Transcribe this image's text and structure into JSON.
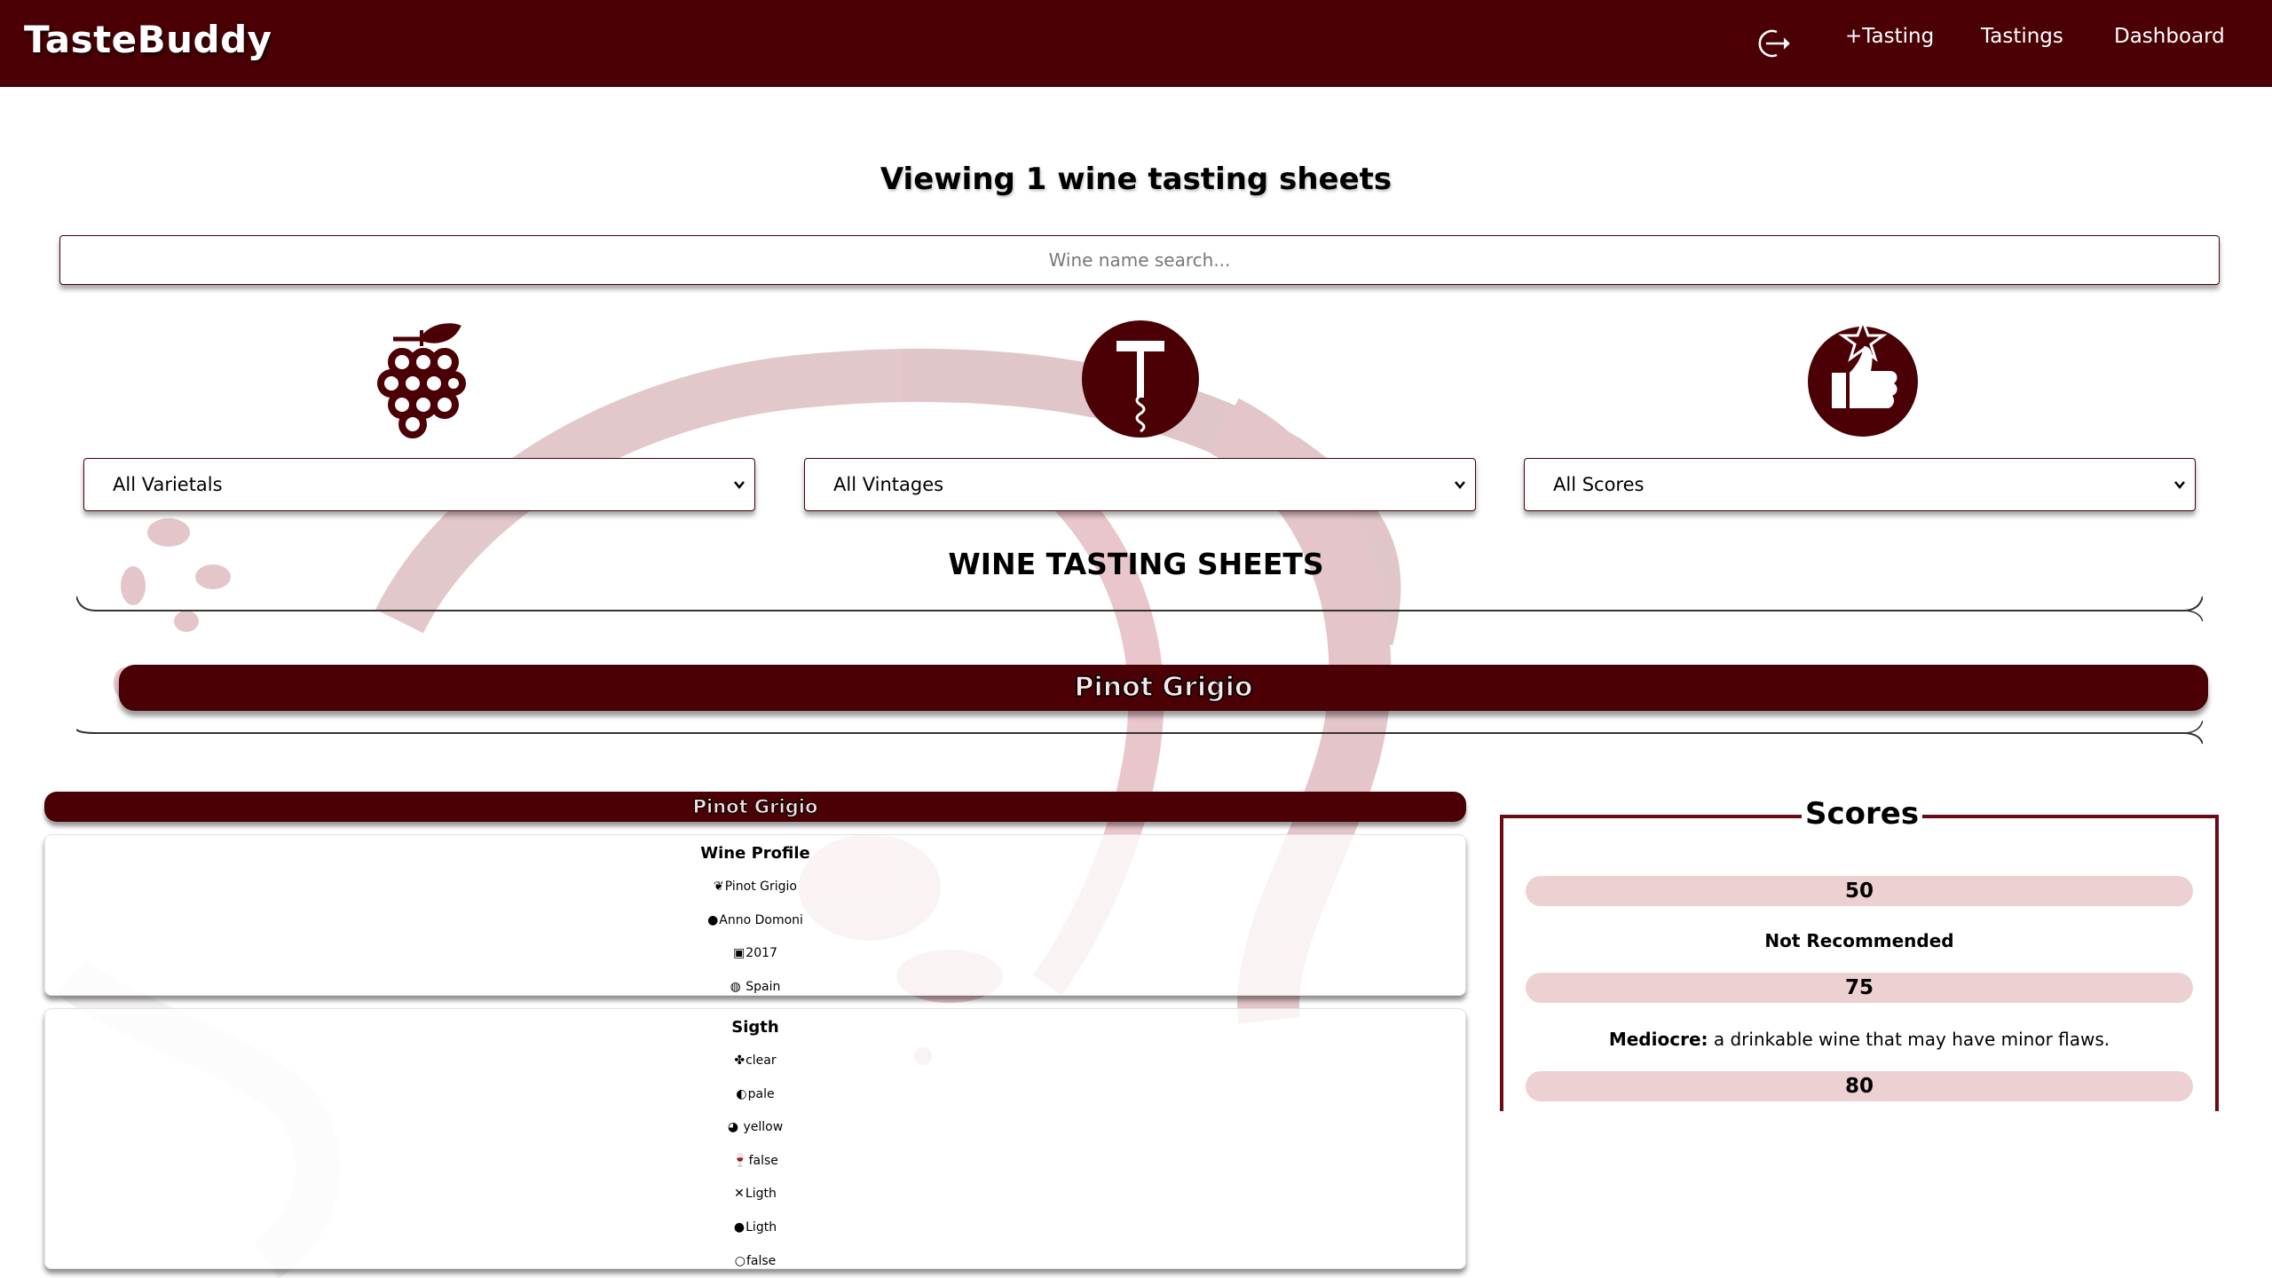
{
  "navbar": {
    "brand": "TasteBuddy",
    "links": [
      "+Tasting",
      "Tastings",
      "Dashboard"
    ],
    "logout_icon": "logout-icon",
    "background": "#4a0005"
  },
  "page_title": "Viewing 1 wine tasting sheets",
  "search": {
    "placeholder": "Wine name search..."
  },
  "filters": [
    {
      "icon": "grape-icon",
      "selected": "All Varietals"
    },
    {
      "icon": "corkscrew-icon",
      "selected": "All Vintages"
    },
    {
      "icon": "thumbs-up-star-icon",
      "selected": "All Scores"
    }
  ],
  "section_title": "WINE TASTING SHEETS",
  "varietal_group": "Pinot Grigio",
  "sheet": {
    "header": "Pinot Grigio",
    "wine_profile": {
      "title": "Wine Profile",
      "items": [
        {
          "icon": "grape-vine-icon",
          "glyph": "❦",
          "text": "Pinot Grigio"
        },
        {
          "icon": "producer-icon",
          "glyph": "●",
          "text": "Anno Domoni"
        },
        {
          "icon": "calendar-icon",
          "glyph": "▣",
          "text": "2017"
        },
        {
          "icon": "globe-icon",
          "glyph": "◍",
          "text": " Spain"
        }
      ]
    },
    "sight": {
      "title": "Sigth",
      "items": [
        {
          "icon": "clarity-icon",
          "glyph": "✤",
          "text": "clear"
        },
        {
          "icon": "intensity-icon",
          "glyph": "◐",
          "text": "pale"
        },
        {
          "icon": "palette-icon",
          "glyph": "◕",
          "text": " yellow"
        },
        {
          "icon": "wine-glass-icon",
          "glyph": "🍷",
          "text": "false"
        },
        {
          "icon": "cross-icon",
          "glyph": "✕",
          "text": "Ligth"
        },
        {
          "icon": "drop-icon",
          "glyph": "●",
          "text": "Ligth"
        },
        {
          "icon": "drop-outline-icon",
          "glyph": "○",
          "text": "false"
        }
      ]
    }
  },
  "scores": {
    "legend": "Scores",
    "rows": [
      {
        "value": "50"
      },
      {
        "label_bold": "Not Recommended",
        "label_rest": ""
      },
      {
        "value": "75"
      },
      {
        "label_bold": "Mediocre:",
        "label_rest": " a drinkable wine that may have minor flaws."
      },
      {
        "value": "80"
      }
    ]
  }
}
